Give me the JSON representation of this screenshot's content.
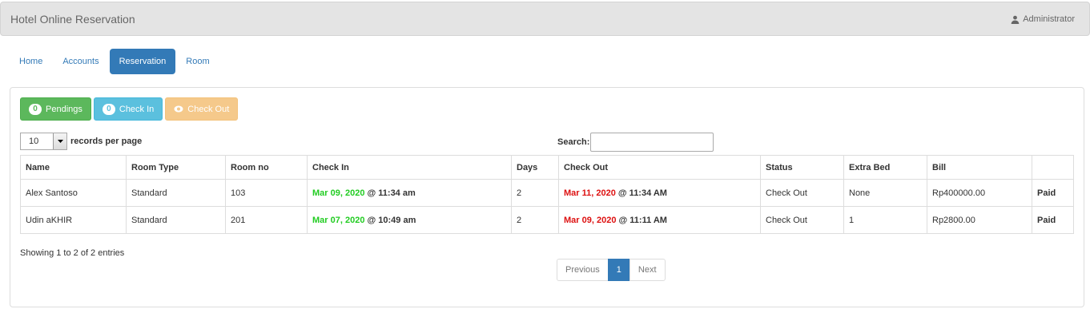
{
  "app": {
    "title": "Hotel Online Reservation",
    "user": "Administrator"
  },
  "nav": [
    {
      "label": "Home"
    },
    {
      "label": "Accounts"
    },
    {
      "label": "Reservation"
    },
    {
      "label": "Room"
    }
  ],
  "actions": {
    "pendings": {
      "count": "0",
      "label": "Pendings"
    },
    "checkin": {
      "count": "0",
      "label": "Check In"
    },
    "checkout": {
      "label": "Check Out"
    }
  },
  "length_menu": {
    "value": "10",
    "label": "records per page"
  },
  "search": {
    "label": "Search:",
    "value": ""
  },
  "table": {
    "headers": [
      "Name",
      "Room Type",
      "Room no",
      "Check In",
      "Days",
      "Check Out",
      "Status",
      "Extra Bed",
      "Bill",
      ""
    ],
    "rows": [
      {
        "name": "Alex Santoso",
        "room_type": "Standard",
        "room_no": "103",
        "checkin_date": "Mar 09, 2020",
        "checkin_time": " @ 11:34 am",
        "days": "2",
        "checkout_date": "Mar 11, 2020",
        "checkout_time": " @ 11:34 AM",
        "status": "Check Out",
        "extra_bed": "None",
        "bill": "Rp400000.00",
        "payment": "Paid"
      },
      {
        "name": "Udin aKHIR",
        "room_type": "Standard",
        "room_no": "201",
        "checkin_date": "Mar 07, 2020",
        "checkin_time": " @ 10:49 am",
        "days": "2",
        "checkout_date": "Mar 09, 2020",
        "checkout_time": " @ 11:11 AM",
        "status": "Check Out",
        "extra_bed": "1",
        "bill": "Rp2800.00",
        "payment": "Paid"
      }
    ]
  },
  "info": "Showing 1 to 2 of 2 entries",
  "pagination": {
    "previous": "Previous",
    "current": "1",
    "next": "Next"
  },
  "colors": {
    "primary": "#337ab7",
    "success": "#5cb85c",
    "info": "#5bc0de",
    "warning": "#f0ad4e",
    "checkin_date": "#22cc22",
    "checkout_date": "#dd1111"
  },
  "icons": {
    "user": "user-icon",
    "checkout": "eye-icon",
    "dropdown": "chevron-down-icon"
  }
}
